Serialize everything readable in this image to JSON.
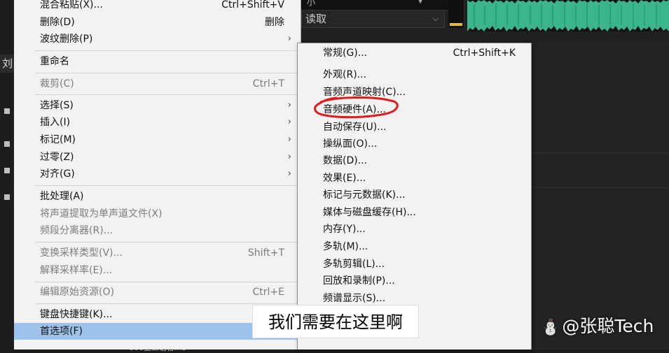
{
  "background": {
    "top_strip_text": "小",
    "dropdown_value": "读取",
    "left_tab_text": "刘",
    "bottom_file_name": "000上课语音.n3"
  },
  "main_menu": {
    "items": [
      {
        "label": "混合粘贴(X)...",
        "shortcut": "Ctrl+Shift+V"
      },
      {
        "label": "删除(D)",
        "shortcut": "删除"
      },
      {
        "label": "波纹删除(P)",
        "arrow": "›"
      },
      {
        "label": "重命名"
      },
      {
        "label": "裁剪(C)",
        "shortcut": "Ctrl+T"
      },
      {
        "label": "选择(S)",
        "arrow": "›"
      },
      {
        "label": "插入(I)",
        "arrow": "›"
      },
      {
        "label": "标记(M)",
        "arrow": "›"
      },
      {
        "label": "过零(Z)",
        "arrow": "›"
      },
      {
        "label": "对齐(G)",
        "arrow": "›"
      },
      {
        "label": "批处理(A)"
      },
      {
        "label": "将声道提取为单声道文件(X)"
      },
      {
        "label": "频段分离器(R)..."
      },
      {
        "label": "变换采样类型(V)...",
        "shortcut": "Shift+T"
      },
      {
        "label": "解释采样率(E)..."
      },
      {
        "label": "编辑原始资源(O)",
        "shortcut": "Ctrl+E"
      },
      {
        "label": "键盘快捷键(K)..."
      },
      {
        "label": "首选项(F)"
      }
    ]
  },
  "submenu": {
    "items": [
      {
        "label": "常规(G)...",
        "shortcut": "Ctrl+Shift+K"
      },
      {
        "label": "外观(R)..."
      },
      {
        "label": "音频声道映射(C)..."
      },
      {
        "label": "音频硬件(A)..."
      },
      {
        "label": "自动保存(U)..."
      },
      {
        "label": "操纵面(O)..."
      },
      {
        "label": "数据(D)..."
      },
      {
        "label": "效果(E)..."
      },
      {
        "label": "标记与元数据(K)..."
      },
      {
        "label": "媒体与磁盘缓存(H)..."
      },
      {
        "label": "内存(Y)..."
      },
      {
        "label": "多轨(M)..."
      },
      {
        "label": "多轨剪辑(L)..."
      },
      {
        "label": "回放和录制(P)..."
      },
      {
        "label": "频谱显示(S)..."
      }
    ]
  },
  "overlay": {
    "subtitle": "我们需要在这里啊",
    "watermark_icon": "⛄",
    "watermark_text": "@张聪Tech"
  },
  "colors": {
    "menu_bg": "#f2f2f2",
    "highlight": "#9ec3ea",
    "waveform": "#3bb58e",
    "annotation_red": "#e01b1b"
  }
}
